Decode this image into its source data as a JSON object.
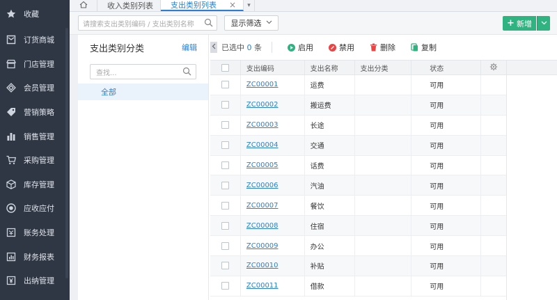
{
  "sidebar": {
    "items": [
      {
        "label": "收藏",
        "icon": "star-icon"
      },
      {
        "label": "订货商城",
        "icon": "cart-box-icon"
      },
      {
        "label": "门店管理",
        "icon": "store-icon"
      },
      {
        "label": "会员管理",
        "icon": "diamond-icon"
      },
      {
        "label": "营销策略",
        "icon": "tag-icon"
      },
      {
        "label": "销售管理",
        "icon": "bar-chart-icon"
      },
      {
        "label": "采购管理",
        "icon": "shopping-cart-icon"
      },
      {
        "label": "库存管理",
        "icon": "package-icon"
      },
      {
        "label": "应收应付",
        "icon": "coin-icon"
      },
      {
        "label": "账务处理",
        "icon": "ledger-icon"
      },
      {
        "label": "财务报表",
        "icon": "report-icon"
      },
      {
        "label": "出纳管理",
        "icon": "cashier-icon"
      }
    ]
  },
  "tabs": {
    "items": [
      {
        "label": "收入类别列表"
      },
      {
        "label": "支出类别列表"
      }
    ],
    "close": "×",
    "more": "▾"
  },
  "toolbar": {
    "search_placeholder": "请搜索支出类别编码 / 支出类别名称",
    "filter_label": "显示筛选",
    "new_label": "新增",
    "new_plus": "+",
    "caret": "▾"
  },
  "category_panel": {
    "title": "支出类别分类",
    "edit_label": "编辑",
    "search_placeholder": "查找...",
    "root_node": "全部"
  },
  "actions": {
    "selected_prefix": "已选中",
    "selected_count": "0",
    "selected_suffix": "条",
    "enable": "启用",
    "disable": "禁用",
    "delete": "删除",
    "copy": "复制"
  },
  "table": {
    "columns": {
      "code": "支出编码",
      "name": "支出名称",
      "category": "支出分类",
      "status": "状态"
    },
    "rows": [
      {
        "code": "ZC00001",
        "name": "运费",
        "category": "",
        "status": "可用"
      },
      {
        "code": "ZC00002",
        "name": "搬运费",
        "category": "",
        "status": "可用"
      },
      {
        "code": "ZC00003",
        "name": "长途",
        "category": "",
        "status": "可用"
      },
      {
        "code": "ZC00004",
        "name": "交通",
        "category": "",
        "status": "可用"
      },
      {
        "code": "ZC00005",
        "name": "话费",
        "category": "",
        "status": "可用"
      },
      {
        "code": "ZC00006",
        "name": "汽油",
        "category": "",
        "status": "可用"
      },
      {
        "code": "ZC00007",
        "name": "餐饮",
        "category": "",
        "status": "可用"
      },
      {
        "code": "ZC00008",
        "name": "住宿",
        "category": "",
        "status": "可用"
      },
      {
        "code": "ZC00009",
        "name": "办公",
        "category": "",
        "status": "可用"
      },
      {
        "code": "ZC00010",
        "name": "补贴",
        "category": "",
        "status": "可用"
      },
      {
        "code": "ZC00011",
        "name": "借款",
        "category": "",
        "status": "可用"
      }
    ]
  },
  "colors": {
    "accent": "#2a7fd4",
    "primary_button": "#2fb380",
    "sidebar_bg": "#2f3744",
    "enable_icon": "#2fb380",
    "disable_icon": "#e84545",
    "delete_icon": "#e84545",
    "copy_icon": "#2fb380"
  }
}
